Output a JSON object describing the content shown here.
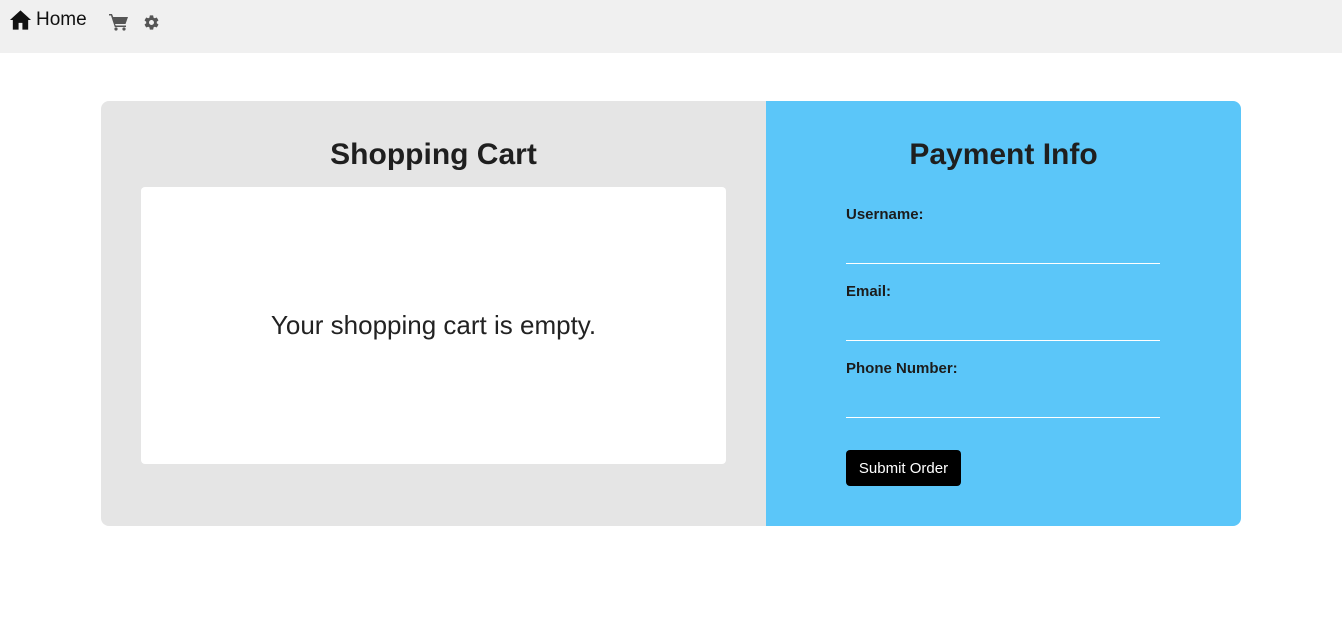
{
  "nav": {
    "home_label": "Home",
    "icons": [
      "home-icon",
      "cart-icon",
      "gear-icon"
    ]
  },
  "cart": {
    "title": "Shopping Cart",
    "empty_message": "Your shopping cart is empty."
  },
  "payment": {
    "title": "Payment Info",
    "fields": {
      "username": {
        "label": "Username:",
        "value": "",
        "placeholder": ""
      },
      "email": {
        "label": "Email:",
        "value": "",
        "placeholder": ""
      },
      "phone": {
        "label": "Phone Number:",
        "value": "",
        "placeholder": ""
      }
    },
    "submit_label": "Submit Order"
  },
  "colors": {
    "topbar_bg": "#f0f0f0",
    "cart_panel_bg": "#e5e5e5",
    "payment_panel_bg": "#5bc6f9",
    "submit_bg": "#000000",
    "icon_color": "#555555"
  }
}
